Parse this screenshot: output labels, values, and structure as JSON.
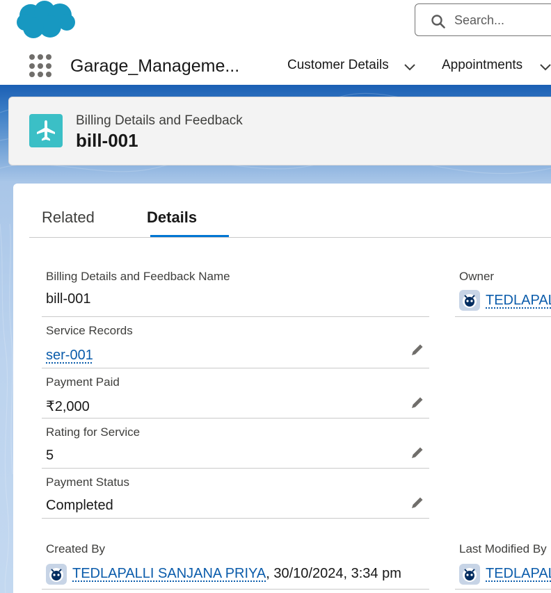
{
  "header": {
    "search_placeholder": "Search...",
    "brand_color": "#1798c1"
  },
  "nav": {
    "app_name": "Garage_Manageme...",
    "items": [
      {
        "label": "Customer Details"
      },
      {
        "label": "Appointments"
      }
    ]
  },
  "record": {
    "object_type": "Billing Details and Feedback",
    "title": "bill-001",
    "icon": "airplane-icon",
    "icon_color": "#3bbfc6"
  },
  "tabs": [
    {
      "label": "Related",
      "active": false
    },
    {
      "label": "Details",
      "active": true
    }
  ],
  "fields": {
    "name": {
      "label": "Billing Details and Feedback Name",
      "value": "bill-001"
    },
    "service_records": {
      "label": "Service Records",
      "value": "ser-001"
    },
    "payment_paid": {
      "label": "Payment Paid",
      "value": "₹2,000"
    },
    "rating": {
      "label": "Rating for Service",
      "value": "5"
    },
    "payment_status": {
      "label": "Payment Status",
      "value": "Completed"
    },
    "owner": {
      "label": "Owner",
      "value": "TEDLAPAL"
    },
    "created_by": {
      "label": "Created By",
      "user": "TEDLAPALLI SANJANA PRIYA",
      "timestamp": ", 30/10/2024, 3:34 pm"
    },
    "last_modified_by": {
      "label": "Last Modified By",
      "user": "TEDLAPAL"
    }
  },
  "colors": {
    "link": "#0b5cab",
    "accent": "#0176d3"
  }
}
